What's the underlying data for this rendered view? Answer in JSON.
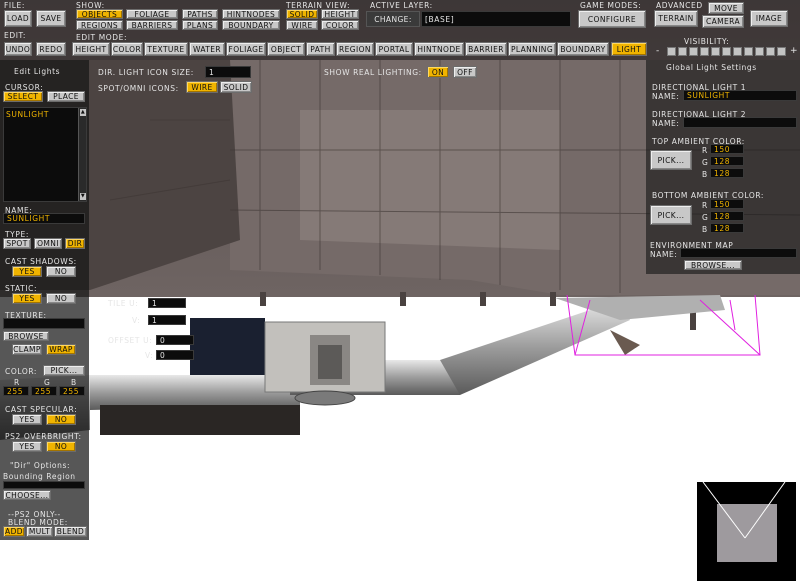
{
  "colors": {
    "accent": "#f0b400",
    "panel_bg": "#1c1c1c",
    "field_bg": "#0c0c0c",
    "button": "#c8c8c8"
  },
  "file": {
    "label": "FILE:",
    "load": "Load",
    "save": "Save"
  },
  "edit": {
    "label": "EDIT:",
    "undo": "Undo",
    "redo": "Redo"
  },
  "show": {
    "label": "SHOW:",
    "objects": "Objects",
    "foliage": "Foliage",
    "paths": "Paths",
    "hintnodes": "HintNodes",
    "regions": "Regions",
    "barriers": "Barriers",
    "plans": "Plans",
    "boundary": "Boundary"
  },
  "terrain_view": {
    "label": "TERRAIN VIEW:",
    "solid": "Solid",
    "height": "Height",
    "wire": "Wire",
    "color": "Color"
  },
  "active_layer": {
    "label": "ACTIVE LAYER:",
    "change": "Change:",
    "value": "[Base]"
  },
  "game_modes": {
    "label": "GAME MODES:",
    "configure": "Configure"
  },
  "advanced": {
    "label": "ADVANCED",
    "move": "Move",
    "terrain": "Terrain",
    "camera": "Camera",
    "image": "Image"
  },
  "edit_mode": {
    "label": "EDIT MODE:",
    "modes": [
      "Height",
      "Color",
      "Texture",
      "Water",
      "Foliage",
      "Object",
      "Path",
      "Region",
      "Portal",
      "HintNode",
      "Barrier",
      "Planning",
      "Boundary",
      "Light"
    ],
    "active": "Light"
  },
  "visibility": {
    "label": "VISIBILITY:",
    "minus": "-",
    "plus": "+"
  },
  "left": {
    "title": "Edit Lights",
    "cursor_label": "CURSOR:",
    "select": "Select",
    "place": "Place",
    "list_items": [
      "SUNLIGHT"
    ],
    "name_label": "NAME:",
    "name_value": "SUNLIGHT",
    "type_label": "TYPE:",
    "spot": "Spot",
    "omni": "Omni",
    "dir": "Dir",
    "cast_shadows_label": "CAST SHADOWS:",
    "cs_yes": "Yes",
    "cs_no": "No",
    "static_label": "STATIC:",
    "st_yes": "Yes",
    "st_no": "No",
    "texture_label": "TEXTURE:",
    "browse": "Browse",
    "clamp": "Clamp",
    "wrap": "Wrap",
    "color_label": "COLOR:",
    "pick": "Pick...",
    "r_label": "R",
    "g_label": "G",
    "b_label": "B",
    "r": "255",
    "g": "255",
    "b": "255",
    "cast_specular_label": "CAST SPECULAR:",
    "sp_yes": "Yes",
    "sp_no": "No",
    "ps2_overbright_label": "PS2 OVERBRIGHT:",
    "ob_yes": "Yes",
    "ob_no": "No",
    "dir_options_label": "\"Dir\" Options:",
    "bounding_region": "Bounding Region",
    "choose": "Choose...",
    "ps2_only": "--PS2 ONLY--",
    "blend_mode": "BLEND MODE:",
    "add": "Add",
    "mult": "Mult",
    "blend": "Blend"
  },
  "top_opts": {
    "dir_icon_size_label": "DIR. LIGHT ICON SIZE:",
    "dir_icon_size": "1",
    "spot_omni_label": "SPOT/OMNI ICONS:",
    "wire": "Wire",
    "solid": "Solid",
    "show_real_label": "SHOW REAL LIGHTING:",
    "on": "On",
    "off": "Off"
  },
  "tile": {
    "tile_u_label": "TILE U:",
    "tile_u": "1",
    "tile_v_label": "V:",
    "tile_v": "1",
    "offset_u_label": "OFFSET U:",
    "offset_u": "0",
    "offset_v_label": "V:",
    "offset_v": "0"
  },
  "right": {
    "title": "Global Light Settings",
    "dl1_label": "DIRECTIONAL LIGHT 1",
    "dl1_name_label": "NAME:",
    "dl1_name": "SUNLIGHT",
    "dl2_label": "DIRECTIONAL LIGHT 2",
    "dl2_name_label": "NAME:",
    "dl2_name": "",
    "top_ambient_label": "TOP AMBIENT COLOR:",
    "top_pick": "Pick...",
    "top_r": "150",
    "top_g": "128",
    "top_b": "128",
    "bottom_ambient_label": "BOTTOM AMBIENT COLOR:",
    "bottom_pick": "Pick...",
    "bot_r": "150",
    "bot_g": "128",
    "bot_b": "128",
    "env_map_label": "ENVIRONMENT MAP",
    "env_name_label": "NAME:",
    "env_name": "",
    "env_browse": "Browse...",
    "r_label": "R",
    "g_label": "G",
    "b_label": "B"
  }
}
